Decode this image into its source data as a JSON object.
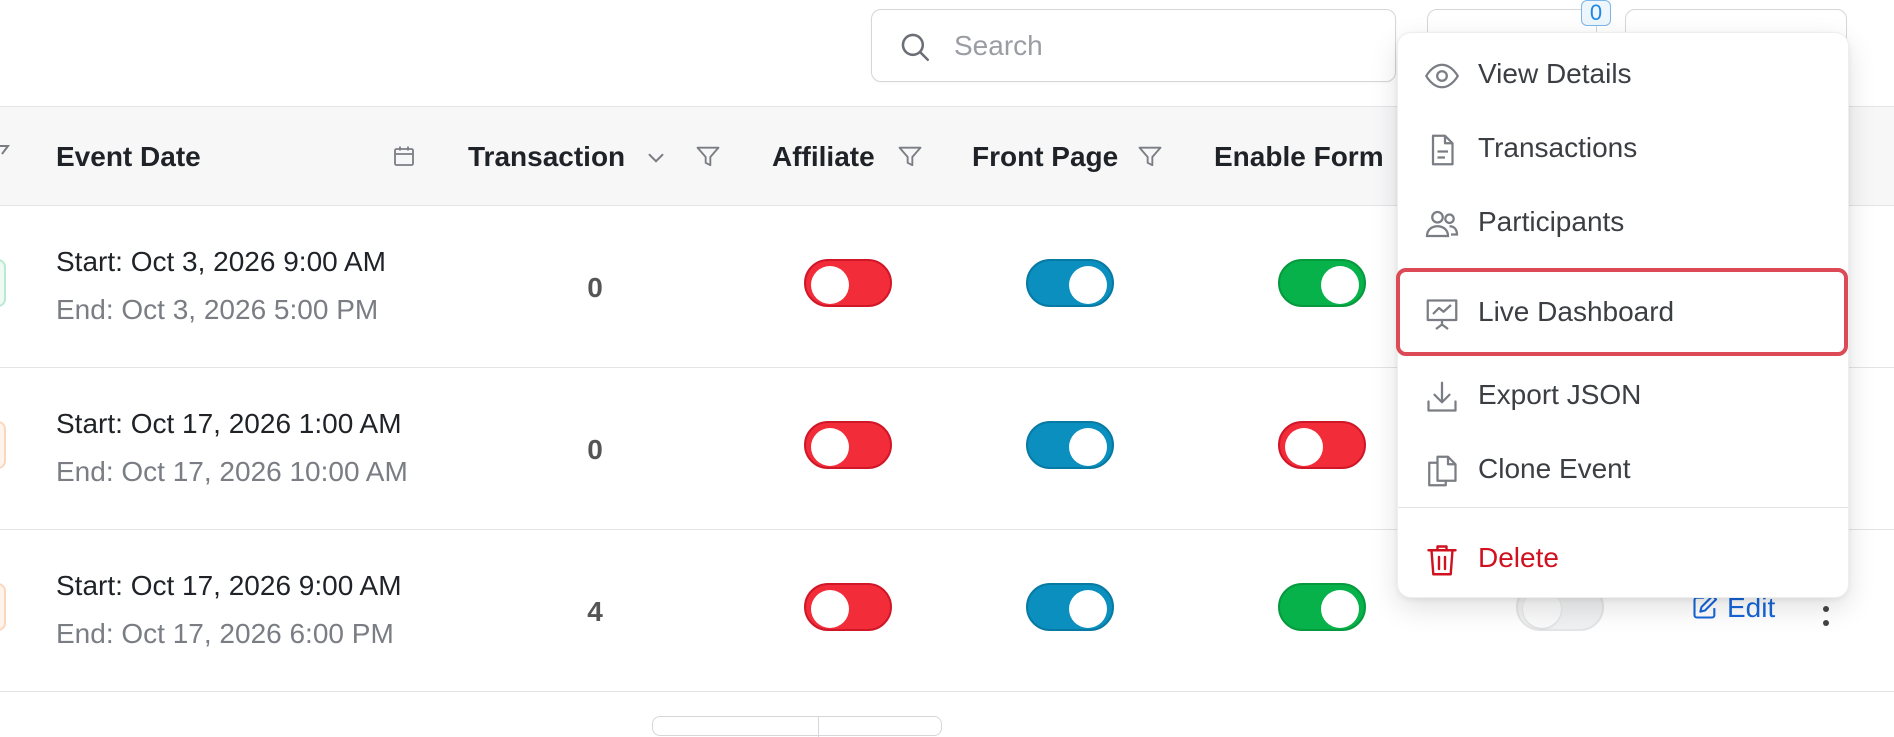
{
  "toolbar": {
    "search_placeholder": "Search",
    "badge_count": "0"
  },
  "table": {
    "columns": [
      "Event Date",
      "Transaction",
      "Affiliate",
      "Front Page",
      "Enable Form"
    ],
    "rows": [
      {
        "start": "Start: Oct 3, 2026 9:00 AM",
        "end": "End: Oct 3, 2026 5:00 PM",
        "transaction": "0",
        "affiliate": false,
        "front_page": true,
        "enable_form": true
      },
      {
        "start": "Start: Oct 17, 2026 1:00 AM",
        "end": "End: Oct 17, 2026 10:00 AM",
        "transaction": "0",
        "affiliate": false,
        "front_page": true,
        "enable_form": false
      },
      {
        "start": "Start: Oct 17, 2026 9:00 AM",
        "end": "End: Oct 17, 2026 6:00 PM",
        "transaction": "4",
        "affiliate": false,
        "front_page": true,
        "enable_form": true,
        "extra_toggle": false
      }
    ],
    "row_actions": {
      "edit_label": "Edit"
    }
  },
  "dropdown": {
    "items": [
      {
        "label": "View Details",
        "icon": "eye-icon"
      },
      {
        "label": "Transactions",
        "icon": "document-icon"
      },
      {
        "label": "Participants",
        "icon": "users-icon"
      },
      {
        "label": "Live Dashboard",
        "icon": "presentation-chart-icon",
        "highlighted": true
      },
      {
        "label": "Export JSON",
        "icon": "download-icon"
      },
      {
        "label": "Clone Event",
        "icon": "copy-icon"
      },
      {
        "label": "Delete",
        "icon": "trash-icon",
        "danger": true
      }
    ]
  },
  "colors": {
    "toggle_off_red": "#f32c3a",
    "toggle_on_blue": "#0a8fbf",
    "toggle_on_green": "#08b24a",
    "highlight_border": "#dc4a55",
    "danger": "#d0111f",
    "link": "#1565d8"
  }
}
